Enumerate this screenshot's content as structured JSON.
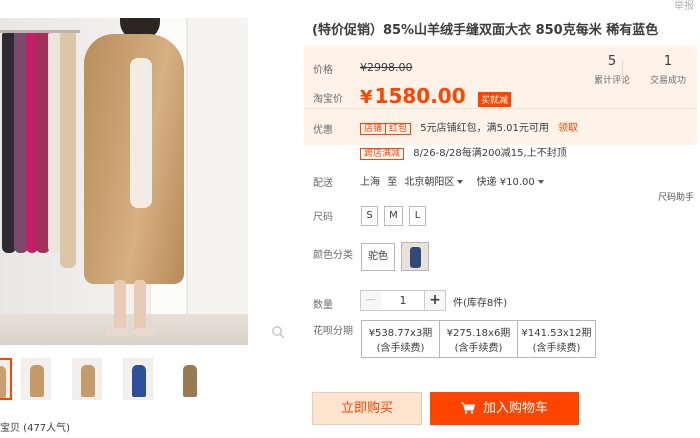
{
  "header": {
    "report_link": "举报"
  },
  "product": {
    "title": "(特价促销）85%山羊绒手缝双面大衣 850克每米 稀有蓝色"
  },
  "price_panel": {
    "price_label": "价格",
    "old_price": "¥2998.00",
    "taobao_price_label": "淘宝价",
    "currency": "¥",
    "new_price": "1580.00",
    "promo_tag": "买就减",
    "stats": [
      {
        "value": "5",
        "label": "累计评论"
      },
      {
        "value": "1",
        "label": "交易成功"
      }
    ],
    "discount_label": "优惠",
    "coupon_tags": [
      "店铺",
      "红包"
    ],
    "coupon_text": "5元店铺红包，满5.01元可用",
    "coupon_link": "领取"
  },
  "promotion": {
    "tag": "跨店满减",
    "text": "8/26-8/28每满200减15,上不封顶"
  },
  "shipping": {
    "label": "配送",
    "from": "上海",
    "to_word": "至",
    "to": "北京朝阳区",
    "method": "快递",
    "fee": "¥10.00"
  },
  "size": {
    "label": "尺码",
    "options": [
      "S",
      "M",
      "L"
    ],
    "guide_link": "尺码助手"
  },
  "color": {
    "label": "颜色分类",
    "options": [
      "驼色"
    ]
  },
  "quantity": {
    "label": "数量",
    "minus": "−",
    "value": "1",
    "plus": "+",
    "stock": "件(库存8件)"
  },
  "installment": {
    "label": "花呗分期",
    "options": [
      {
        "amount": "¥538.77x3期",
        "fee": "(含手续费)"
      },
      {
        "amount": "¥275.18x6期",
        "fee": "(含手续费)"
      },
      {
        "amount": "¥141.53x12期",
        "fee": "(含手续费)"
      }
    ]
  },
  "actions": {
    "buy_now": "立即购买",
    "add_to_cart": "加入购物车"
  },
  "gallery": {
    "favorites": "宝贝 (477人气)",
    "accent_color": "#ff4400"
  }
}
